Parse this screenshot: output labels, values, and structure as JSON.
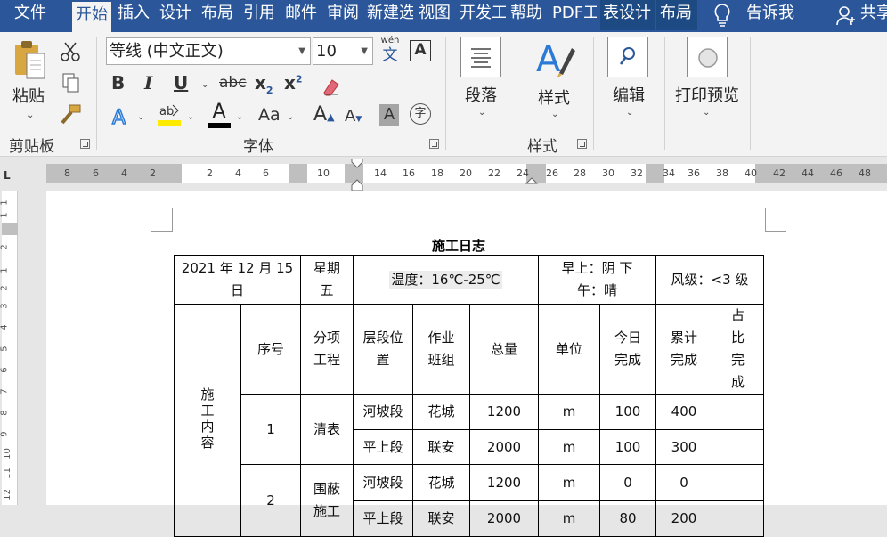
{
  "tabs": [
    {
      "label": "文件",
      "active": false,
      "context": false
    },
    {
      "label": "开始",
      "active": true,
      "context": false
    },
    {
      "label": "插入",
      "active": false,
      "context": false
    },
    {
      "label": "设计",
      "active": false,
      "context": false
    },
    {
      "label": "布局",
      "active": false,
      "context": false
    },
    {
      "label": "引用",
      "active": false,
      "context": false
    },
    {
      "label": "邮件",
      "active": false,
      "context": false
    },
    {
      "label": "审阅",
      "active": false,
      "context": false
    },
    {
      "label": "新建选",
      "active": false,
      "context": false
    },
    {
      "label": "视图",
      "active": false,
      "context": false
    },
    {
      "label": "开发工",
      "active": false,
      "context": false
    },
    {
      "label": "帮助",
      "active": false,
      "context": false
    },
    {
      "label": "PDF工",
      "active": false,
      "context": false
    },
    {
      "label": "表设计",
      "active": false,
      "context": true
    },
    {
      "label": "布局",
      "active": false,
      "context": true
    }
  ],
  "tell_me": "告诉我",
  "share": "共享",
  "ribbon": {
    "clipboard": {
      "paste": "粘贴",
      "label": "剪贴板"
    },
    "font": {
      "name": "等线 (中文正文)",
      "size": "10",
      "phonetic_top": "wén",
      "phonetic_bottom": "文",
      "label": "字体",
      "bold": "B",
      "italic": "I",
      "underline": "U",
      "strike": "abc",
      "subscript_base": "x",
      "subscript_mark": "2",
      "superscript_base": "x",
      "superscript_mark": "2",
      "font_color": "A",
      "case": "Aa",
      "grow": "A",
      "shrink": "A",
      "shade": "A",
      "enclose": "字",
      "border_char": "A"
    },
    "paragraph": {
      "label": "段落"
    },
    "styles": {
      "button": "样式",
      "label": "样式"
    },
    "editing": {
      "label": "编辑"
    },
    "print_preview": {
      "label": "打印预览"
    }
  },
  "ruler": {
    "numbers": [
      "8",
      "6",
      "4",
      "2",
      "2",
      "4",
      "6",
      "10",
      "14",
      "16",
      "18",
      "20",
      "22",
      "24",
      "26",
      "28",
      "30",
      "32",
      "34",
      "36",
      "38",
      "40",
      "42",
      "44",
      "46",
      "48"
    ],
    "vnumbers": [
      "1",
      "1",
      "2",
      "1",
      "2",
      "3",
      "4",
      "5",
      "6",
      "7",
      "8",
      "9",
      "10",
      "11",
      "12"
    ]
  },
  "document": {
    "title": "施工日志",
    "date": "2021 年 12 月 15 日",
    "weekday": "星期五",
    "temperature": "温度：16℃-25℃",
    "weather": "早上：阴  下午：晴",
    "wind": "风级：<3 级",
    "section_label": "施工内容",
    "headers": [
      "序号",
      "分项工程",
      "层段位置",
      "作业班组",
      "总量",
      "单位",
      "今日完成",
      "累计完成",
      "占比完成"
    ],
    "groups": [
      {
        "no": "1",
        "item": "清表",
        "rows": [
          {
            "pos": "河坡段",
            "team": "花城",
            "total": "1200",
            "unit": "m",
            "today": "100",
            "cumulative": "400",
            "ratio": ""
          },
          {
            "pos": "平上段",
            "team": "联安",
            "total": "2000",
            "unit": "m",
            "today": "100",
            "cumulative": "300",
            "ratio": ""
          }
        ]
      },
      {
        "no": "2",
        "item": "围蔽施工",
        "rows": [
          {
            "pos": "河坡段",
            "team": "花城",
            "total": "1200",
            "unit": "m",
            "today": "0",
            "cumulative": "0",
            "ratio": ""
          },
          {
            "pos": "平上段",
            "team": "联安",
            "total": "2000",
            "unit": "m",
            "today": "80",
            "cumulative": "200",
            "ratio": ""
          }
        ]
      }
    ]
  }
}
